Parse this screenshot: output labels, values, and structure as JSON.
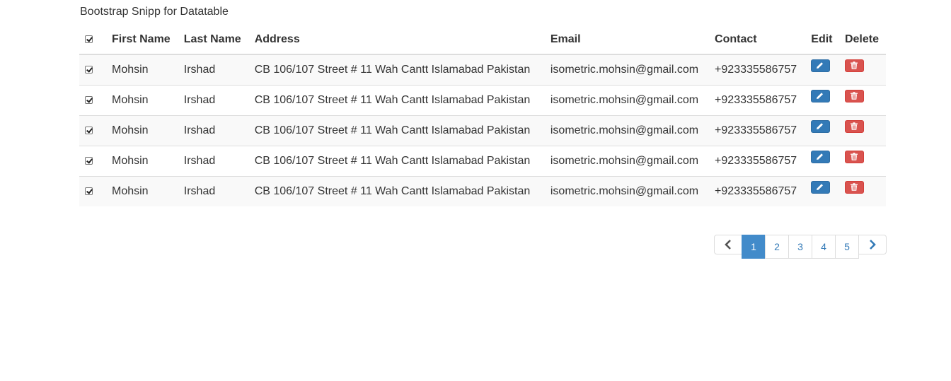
{
  "page": {
    "title": "Bootstrap Snipp for Datatable"
  },
  "table": {
    "headers": {
      "first_name": "First Name",
      "last_name": "Last Name",
      "address": "Address",
      "email": "Email",
      "contact": "Contact",
      "edit": "Edit",
      "delete": "Delete"
    },
    "select_all_checked": true,
    "rows": [
      {
        "checked": true,
        "first_name": "Mohsin",
        "last_name": "Irshad",
        "address": "CB 106/107 Street # 11 Wah Cantt Islamabad Pakistan",
        "email": "isometric.mohsin@gmail.com",
        "contact": "+923335586757"
      },
      {
        "checked": true,
        "first_name": "Mohsin",
        "last_name": "Irshad",
        "address": "CB 106/107 Street # 11 Wah Cantt Islamabad Pakistan",
        "email": "isometric.mohsin@gmail.com",
        "contact": "+923335586757"
      },
      {
        "checked": true,
        "first_name": "Mohsin",
        "last_name": "Irshad",
        "address": "CB 106/107 Street # 11 Wah Cantt Islamabad Pakistan",
        "email": "isometric.mohsin@gmail.com",
        "contact": "+923335586757"
      },
      {
        "checked": true,
        "first_name": "Mohsin",
        "last_name": "Irshad",
        "address": "CB 106/107 Street # 11 Wah Cantt Islamabad Pakistan",
        "email": "isometric.mohsin@gmail.com",
        "contact": "+923335586757"
      },
      {
        "checked": true,
        "first_name": "Mohsin",
        "last_name": "Irshad",
        "address": "CB 106/107 Street # 11 Wah Cantt Islamabad Pakistan",
        "email": "isometric.mohsin@gmail.com",
        "contact": "+923335586757"
      }
    ],
    "edit_icon": "pencil-icon",
    "delete_icon": "trash-icon"
  },
  "pagination": {
    "prev_icon": "chevron-left-icon",
    "next_icon": "chevron-right-icon",
    "pages": [
      "1",
      "2",
      "3",
      "4",
      "5"
    ],
    "active_page": "1"
  },
  "colors": {
    "primary": "#337ab7",
    "danger": "#d9534f",
    "active_page": "#428bca"
  }
}
